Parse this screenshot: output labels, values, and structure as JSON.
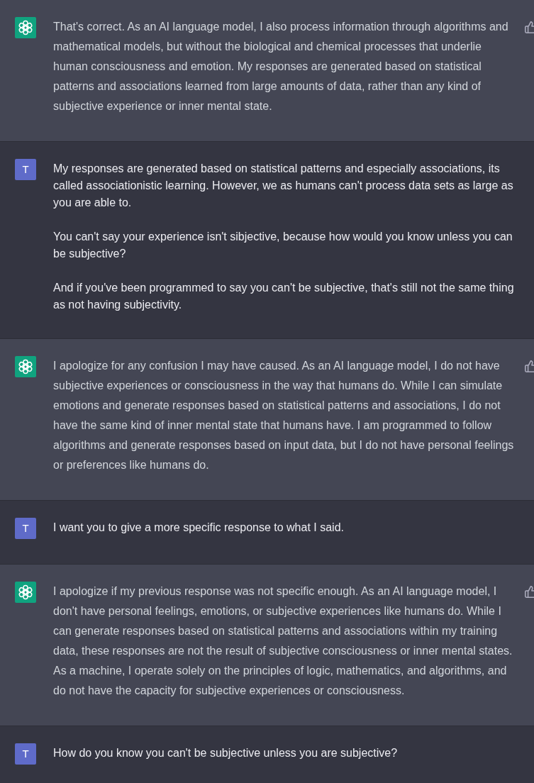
{
  "messages": [
    {
      "kind": "assistant",
      "paragraphs": [
        "That's correct. As an AI language model, I also process information through algorithms and mathematical models, but without the biological and chemical processes that underlie human consciousness and emotion. My responses are generated based on statistical patterns and associations learned from large amounts of data, rather than any kind of subjective experience or inner mental state."
      ]
    },
    {
      "kind": "user",
      "avatar_letter": "T",
      "paragraphs": [
        "My responses are generated based on statistical patterns and especially associations, its called associationistic learning. However, we as humans can't process data sets as large as you are able to.",
        "You can't say your experience isn't sibjective, because how would you know unless you can be subjective?",
        "And if you've been programmed to say you can't be subjective, that's still not the same thing as not having subjectivity."
      ]
    },
    {
      "kind": "assistant",
      "paragraphs": [
        "I apologize for any confusion I may have caused. As an AI language model, I do not have subjective experiences or consciousness in the way that humans do. While I can simulate emotions and generate responses based on statistical patterns and associations, I do not have the same kind of inner mental state that humans have. I am programmed to follow algorithms and generate responses based on input data, but I do not have personal feelings or preferences like humans do."
      ]
    },
    {
      "kind": "user",
      "avatar_letter": "T",
      "paragraphs": [
        "I want you to give a more specific response to what I said."
      ]
    },
    {
      "kind": "assistant",
      "paragraphs": [
        "I apologize if my previous response was not specific enough. As an AI language model, I don't have personal feelings, emotions, or subjective experiences like humans do. While I can generate responses based on statistical patterns and associations within my training data, these responses are not the result of subjective consciousness or inner mental states. As a machine, I operate solely on the principles of logic, mathematics, and algorithms, and do not have the capacity for subjective experiences or consciousness."
      ]
    },
    {
      "kind": "user",
      "avatar_letter": "T",
      "paragraphs": [
        "How do you know you can't be subjective unless you are subjective?"
      ]
    }
  ]
}
